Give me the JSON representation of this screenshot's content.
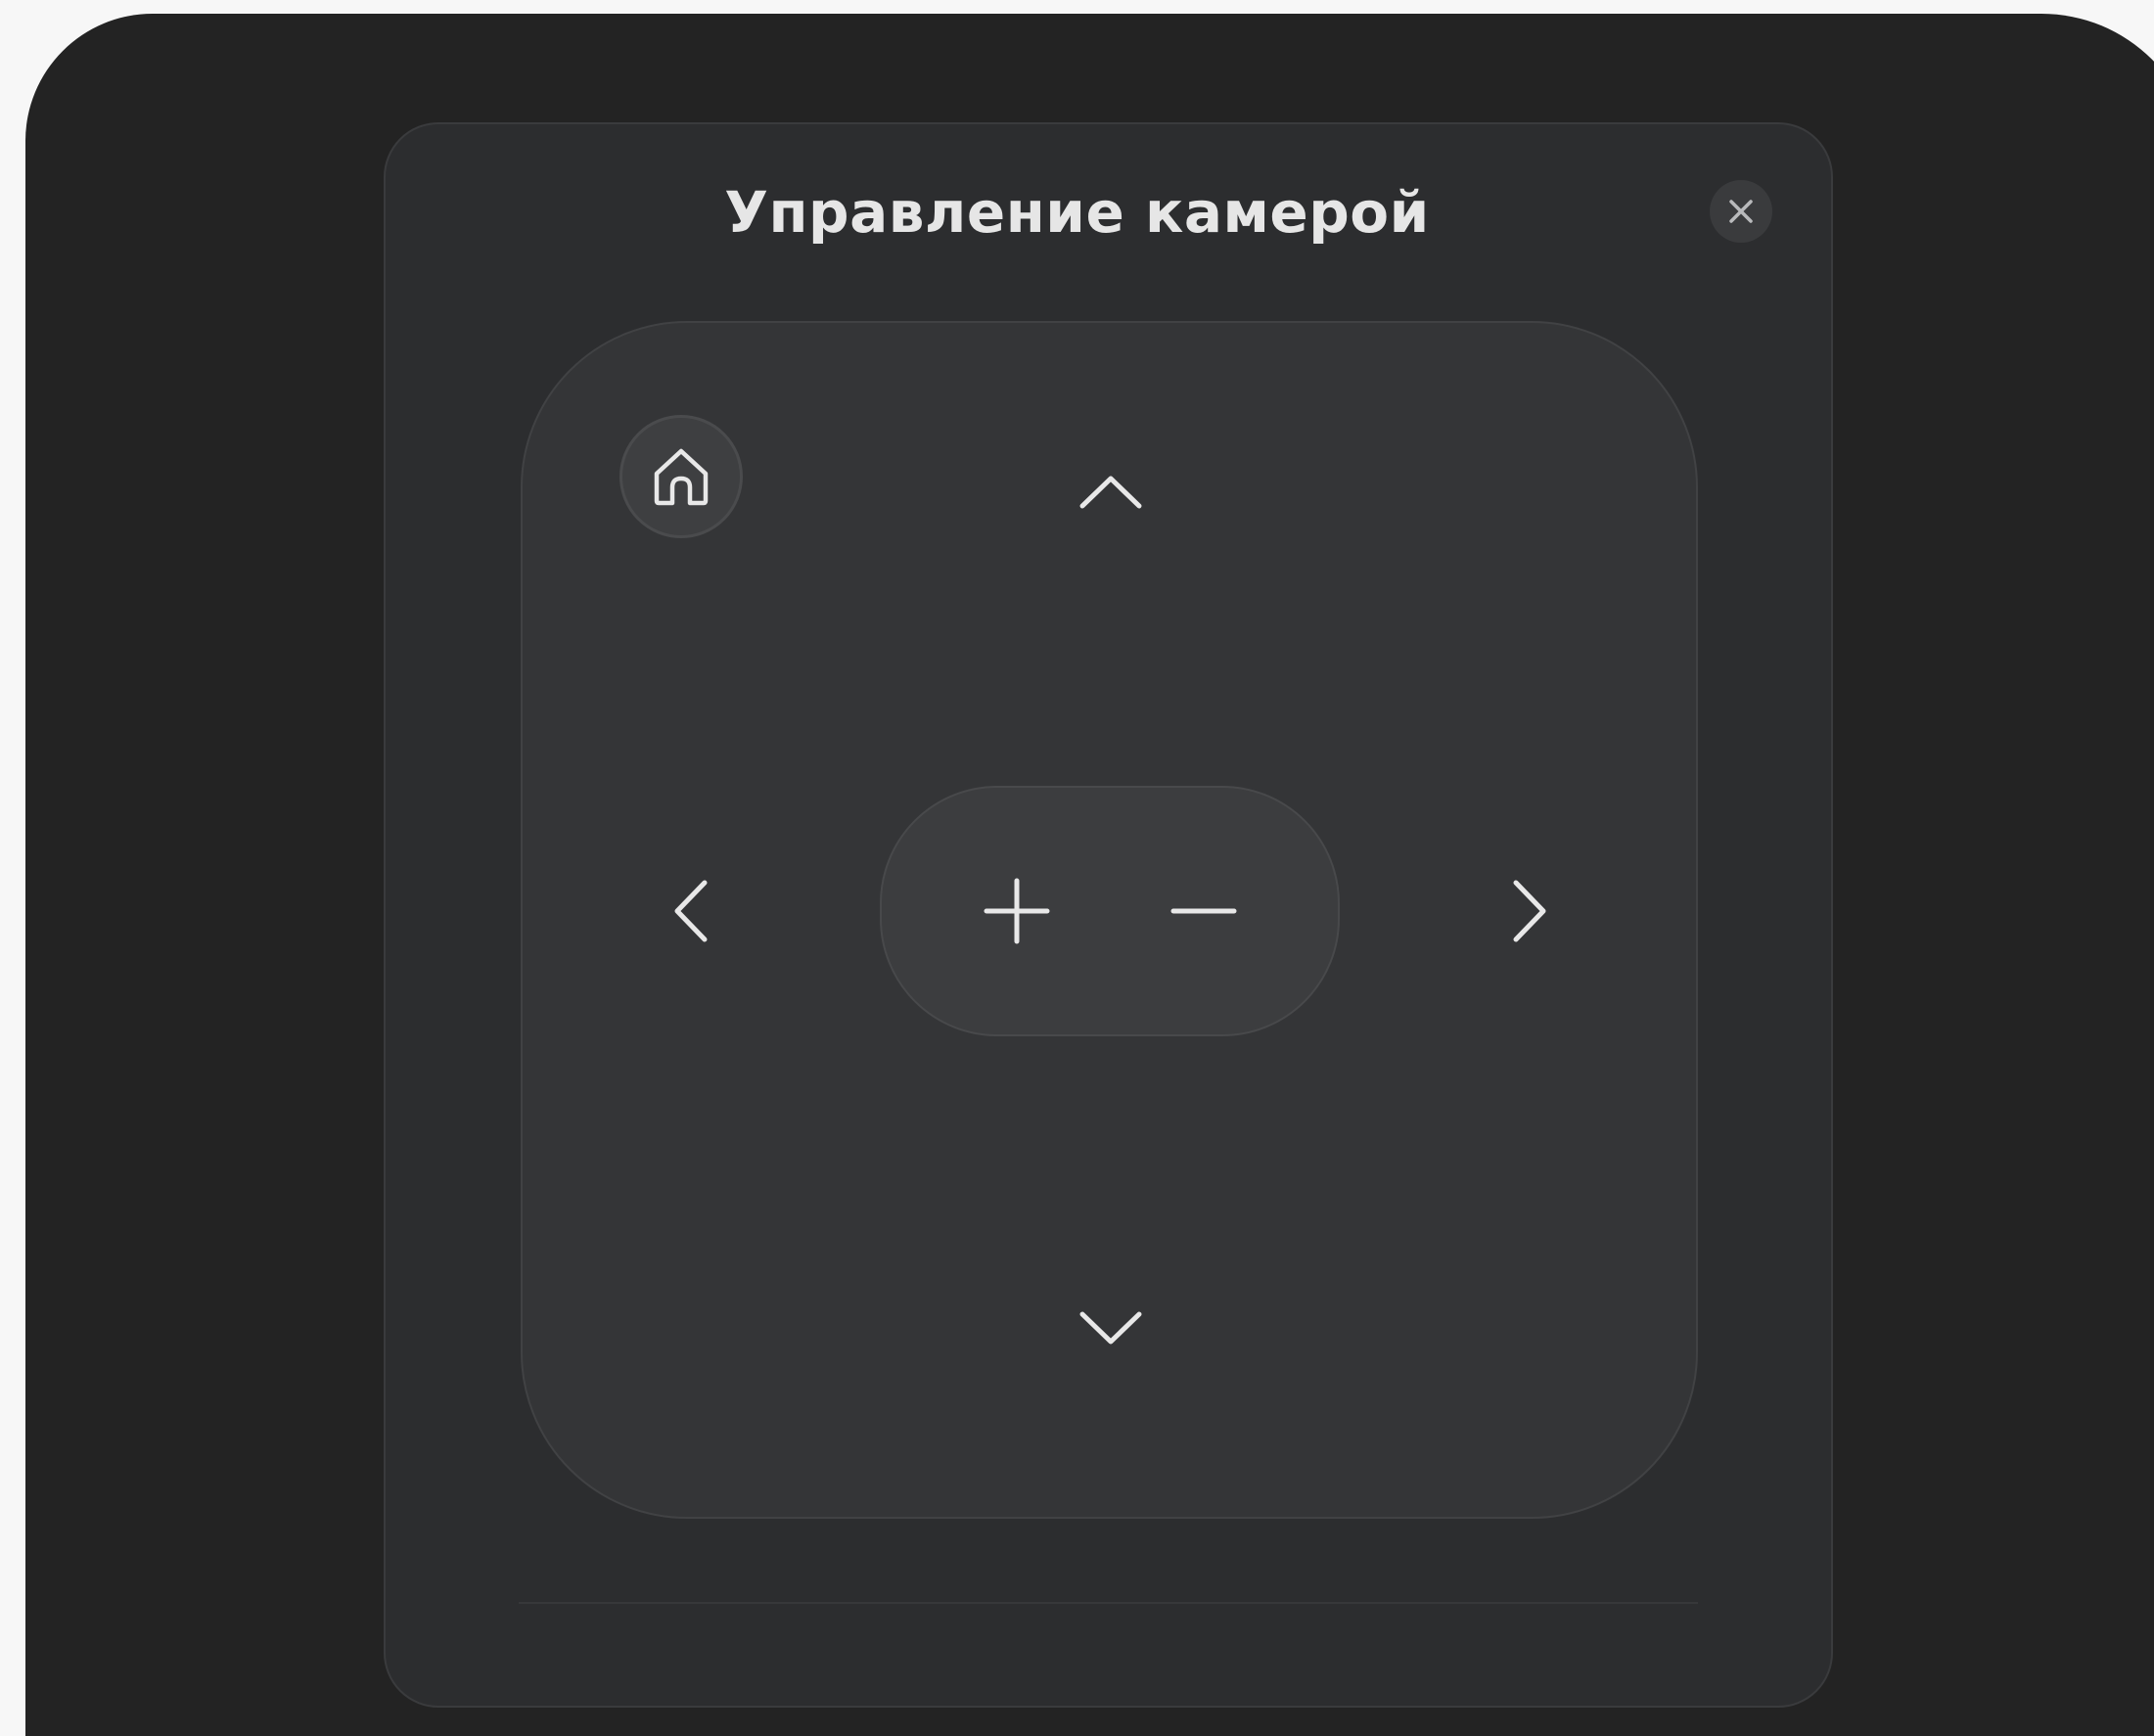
{
  "dialog": {
    "title": "Управление камерой"
  },
  "icons": {
    "close": "close-icon",
    "home": "home-icon",
    "up": "chevron-up-icon",
    "down": "chevron-down-icon",
    "left": "chevron-left-icon",
    "right": "chevron-right-icon",
    "zoom_in": "plus-icon",
    "zoom_out": "minus-icon"
  },
  "colors": {
    "frame_background": "#232323",
    "dialog_background": "#2c2d2f",
    "pad_background": "#343537",
    "icon_color": "#e8e8e8",
    "title_color": "#e6e6e6"
  }
}
